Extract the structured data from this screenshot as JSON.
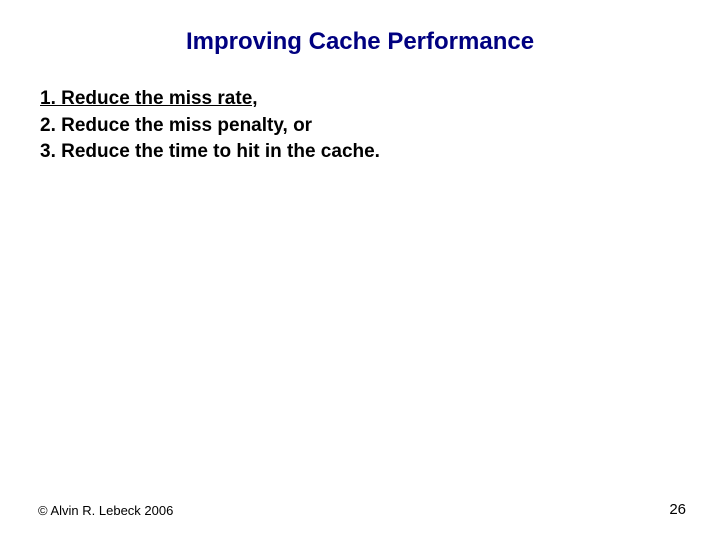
{
  "title": "Improving Cache Performance",
  "items": {
    "i1": "1. Reduce the miss rate,",
    "i2": "2. Reduce the miss penalty, or",
    "i3": "3. Reduce the time to hit in the cache."
  },
  "footer": {
    "copyright": "© Alvin R. Lebeck 2006",
    "page": "26"
  }
}
